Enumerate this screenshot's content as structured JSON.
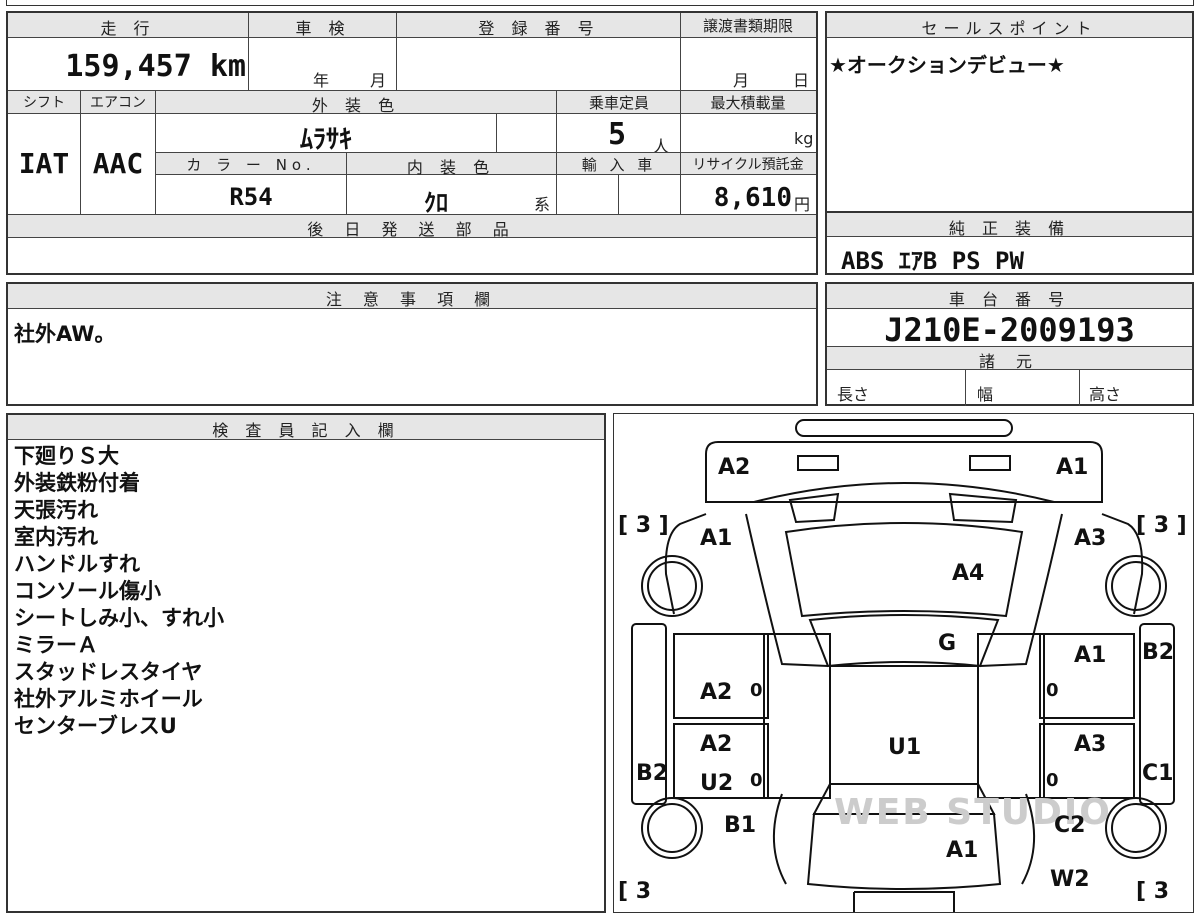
{
  "top_form": {
    "mileage_label": "走 行",
    "mileage_value": "159,457 km",
    "inspection_label": "車 検",
    "inspection_year_unit": "年",
    "inspection_month_unit": "月",
    "registration_label": "登 録 番 号",
    "transfer_deadline_label": "譲渡書類期限",
    "transfer_month_unit": "月",
    "transfer_day_unit": "日",
    "shift_label": "シフト",
    "aircon_label": "エアコン",
    "exterior_color_label": "外 装 色",
    "capacity_label": "乗車定員",
    "max_load_label": "最大積載量",
    "shift_value": "IAT",
    "aircon_value": "AAC",
    "exterior_color_value": "ﾑﾗｻｷ",
    "capacity_value": "5",
    "capacity_unit": "人",
    "max_load_unit": "kg",
    "color_no_label": "カ ラ ー No.",
    "interior_color_label": "内 装 色",
    "import_label": "輸 入 車",
    "recycle_label": "リサイクル預託金",
    "color_no_value": "R54",
    "interior_color_value": "ｸﾛ",
    "interior_color_unit": "系",
    "recycle_value": "8,610",
    "recycle_unit": "円",
    "later_parts_label": "後 日 発 送 部 品"
  },
  "sales_point": {
    "label": "セールスポイント",
    "text": "★オークションデビュー★"
  },
  "standard_equipment": {
    "label": "純 正 装 備",
    "text": "ABS ｴｱB PS PW"
  },
  "notes": {
    "label": "注 意 事 項 欄",
    "text": "社外AW。"
  },
  "chassis": {
    "label": "車 台 番 号",
    "value": "J210E-2009193",
    "specs_label": "諸 元",
    "length_label": "長さ",
    "width_label": "幅",
    "height_label": "高さ"
  },
  "inspector": {
    "label": "検 査 員 記 入 欄",
    "lines": [
      "下廻りＳ大",
      "外装鉄粉付着",
      "天張汚れ",
      "室内汚れ",
      "ハンドルすれ",
      "コンソール傷小",
      "シートしみ小、すれ小",
      "ミラーＡ",
      "スタッドレスタイヤ",
      "社外アルミホイール",
      "センターブレスU"
    ]
  },
  "diagram": {
    "marks": {
      "front_left_corner": "A2",
      "front_right_corner": "A1",
      "tire_front_left": "[ 3 ]",
      "tire_front_right": "[ 3 ]",
      "tire_rear_left": "[ 3",
      "tire_rear_right": "[ 3",
      "fender_front_left": "A1",
      "fender_front_right": "A3",
      "hood": "A4",
      "windshield": "G",
      "front_door_left": "A2",
      "front_door_right": "A1",
      "pillar_right": "B2",
      "rear_door_left_a": "A2",
      "rear_door_left_b": "U2",
      "rear_door_right": "A3",
      "roof": "U1",
      "sill_left": "B2",
      "sill_right": "C1",
      "quarter_left": "B1",
      "quarter_right": "C2",
      "trunk": "A1",
      "rear_right": "W2",
      "door_left_front_zero": "0",
      "door_right_front_zero": "0",
      "door_left_rear_zero": "0",
      "door_right_rear_zero": "0"
    },
    "watermark": "WEB STUDIO"
  }
}
